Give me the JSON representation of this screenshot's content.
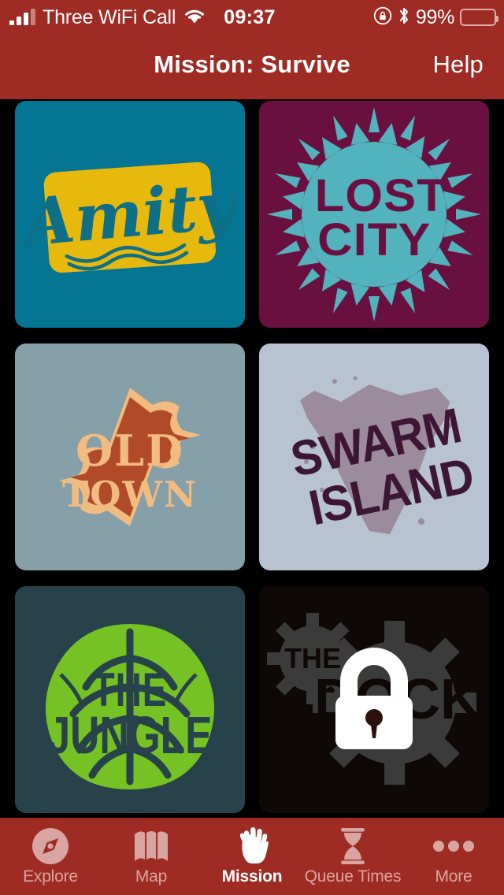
{
  "status_bar": {
    "signal_icon": "signal-bars-icon",
    "carrier": "Three WiFi Call",
    "wifi_icon": "wifi-icon",
    "time": "09:37",
    "rotation_lock_icon": "rotation-lock-icon",
    "bluetooth_icon": "bluetooth-icon",
    "battery_percent": "99%",
    "battery_icon": "battery-full-icon"
  },
  "nav_bar": {
    "title": "Mission: Survive",
    "help_label": "Help"
  },
  "colors": {
    "brand_red": "#9e2b24",
    "tab_inactive": "#d9a5a1",
    "tab_active": "#ffffff",
    "page_background": "#000000"
  },
  "grid": {
    "cards": [
      {
        "id": "amity",
        "name": "Amity",
        "locked": false,
        "background": "#047593",
        "plaque": "#e8b90d",
        "ink": "#0e6f87",
        "logo_text": "Amity"
      },
      {
        "id": "lost-city",
        "name": "Lost City",
        "locked": false,
        "background": "#6a1040",
        "sun": "#52b3bd",
        "ink": "#6a1040",
        "logo_text_line1": "LOST",
        "logo_text_line2": "CITY"
      },
      {
        "id": "old-town",
        "name": "Old Town",
        "locked": false,
        "background": "#85a0a8",
        "plaque": "#b04a28",
        "ink": "#f2bb80",
        "logo_text_line1": "OLD",
        "logo_text_line2": "TOWN"
      },
      {
        "id": "swarm-island",
        "name": "Swarm Island",
        "locked": false,
        "background": "#b8c3d1",
        "splat": "#9b8b9c",
        "ink": "#3d1535",
        "logo_text_line1": "SWARM",
        "logo_text_line2": "ISLAND"
      },
      {
        "id": "the-jungle",
        "name": "The Jungle",
        "locked": false,
        "background": "#27424a",
        "leaf": "#76c224",
        "ink": "#27424a",
        "logo_text_line1": "THE",
        "logo_text_line2": "JUNGLE"
      },
      {
        "id": "the-dock",
        "name": "The Dock",
        "locked": true,
        "background": "#2b100e",
        "gear": "#6f6f6f",
        "ink": "#2b100e",
        "logo_text_line1": "THE",
        "logo_text_line2": "DOCK",
        "lock_icon": "lock-icon"
      }
    ]
  },
  "tab_bar": {
    "tabs": [
      {
        "label": "Explore",
        "icon": "compass-icon",
        "active": false
      },
      {
        "label": "Map",
        "icon": "map-icon",
        "active": false
      },
      {
        "label": "Mission",
        "icon": "hand-icon",
        "active": true
      },
      {
        "label": "Queue Times",
        "icon": "hourglass-icon",
        "active": false
      },
      {
        "label": "More",
        "icon": "ellipsis-icon",
        "active": false
      }
    ]
  }
}
